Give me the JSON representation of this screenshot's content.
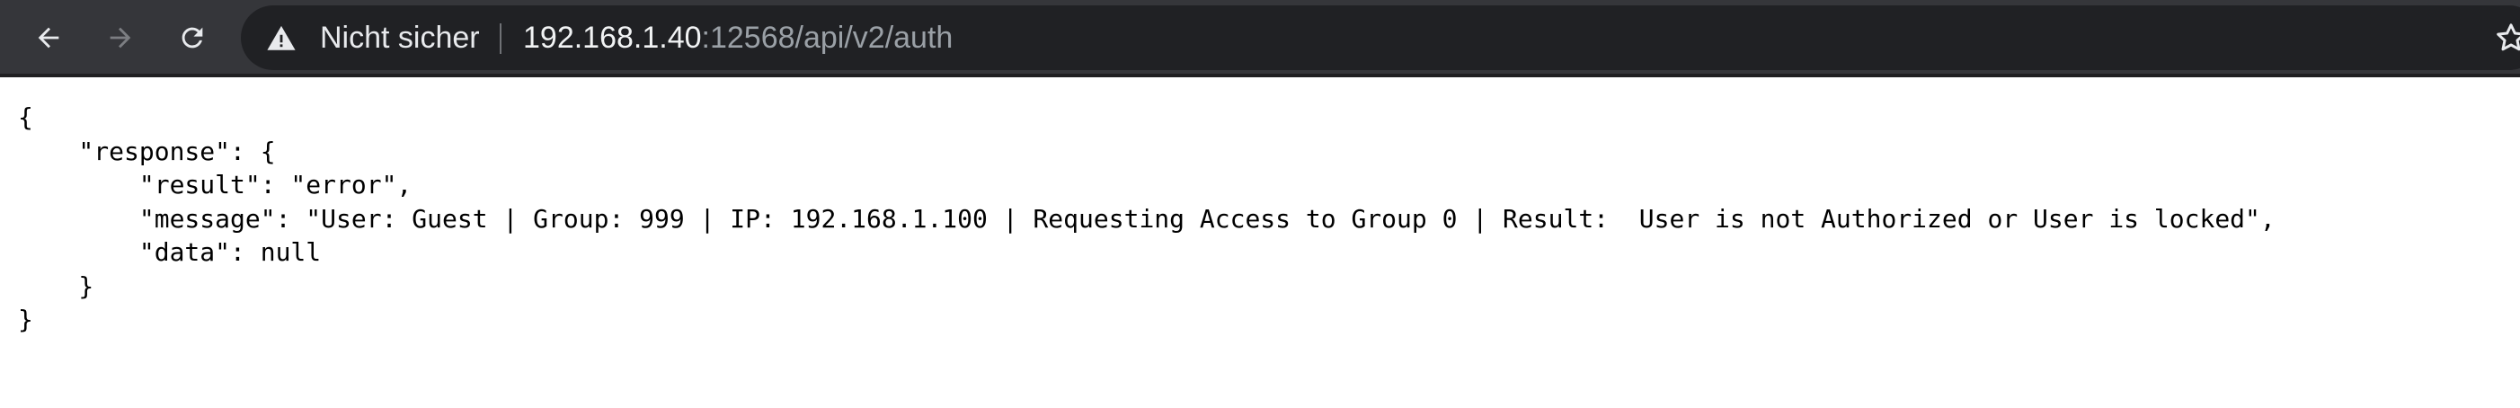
{
  "browser": {
    "security_label": "Nicht sicher",
    "url_host": "192.168.1.40",
    "url_rest": ":12568/api/v2/auth",
    "colors": {
      "toolbar": "#35363a",
      "omnibox": "#202124",
      "url_host": "#f1f3f4",
      "url_dim": "#9aa0a6"
    },
    "icons": [
      "back-arrow-icon",
      "forward-arrow-icon",
      "reload-icon",
      "warning-triangle-icon",
      "bookmark-star-icon"
    ]
  },
  "json_text": {
    "lines": [
      "{",
      "    \"response\": {",
      "        \"result\": \"error\",",
      "        \"message\": \"User: Guest | Group: 999 | IP: 192.168.1.100 | Requesting Access to Group 0 | Result:  User is not Authorized or User is locked\",",
      "        \"data\": null",
      "    }",
      "}"
    ]
  }
}
